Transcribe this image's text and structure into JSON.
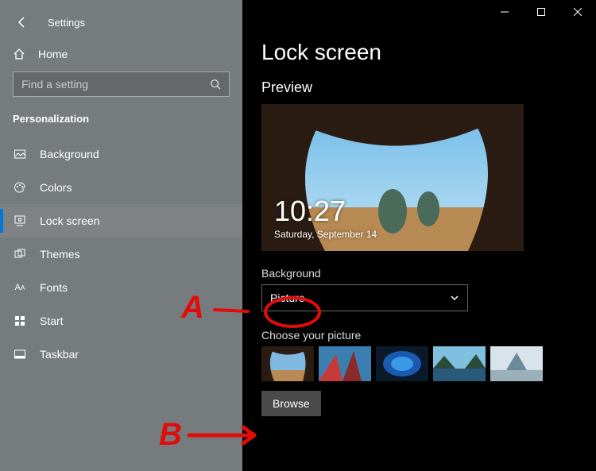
{
  "sidebar": {
    "title": "Settings",
    "home_label": "Home",
    "search_placeholder": "Find a setting",
    "section_label": "Personalization",
    "items": [
      {
        "label": "Background"
      },
      {
        "label": "Colors"
      },
      {
        "label": "Lock screen"
      },
      {
        "label": "Themes"
      },
      {
        "label": "Fonts"
      },
      {
        "label": "Start"
      },
      {
        "label": "Taskbar"
      }
    ]
  },
  "main": {
    "page_title": "Lock screen",
    "preview_label": "Preview",
    "preview_time": "10:27",
    "preview_date": "Saturday, September 14",
    "background_label": "Background",
    "background_dropdown_value": "Picture",
    "choose_picture_label": "Choose your picture",
    "browse_label": "Browse"
  },
  "annotations": {
    "a_label": "A",
    "b_label": "B"
  }
}
